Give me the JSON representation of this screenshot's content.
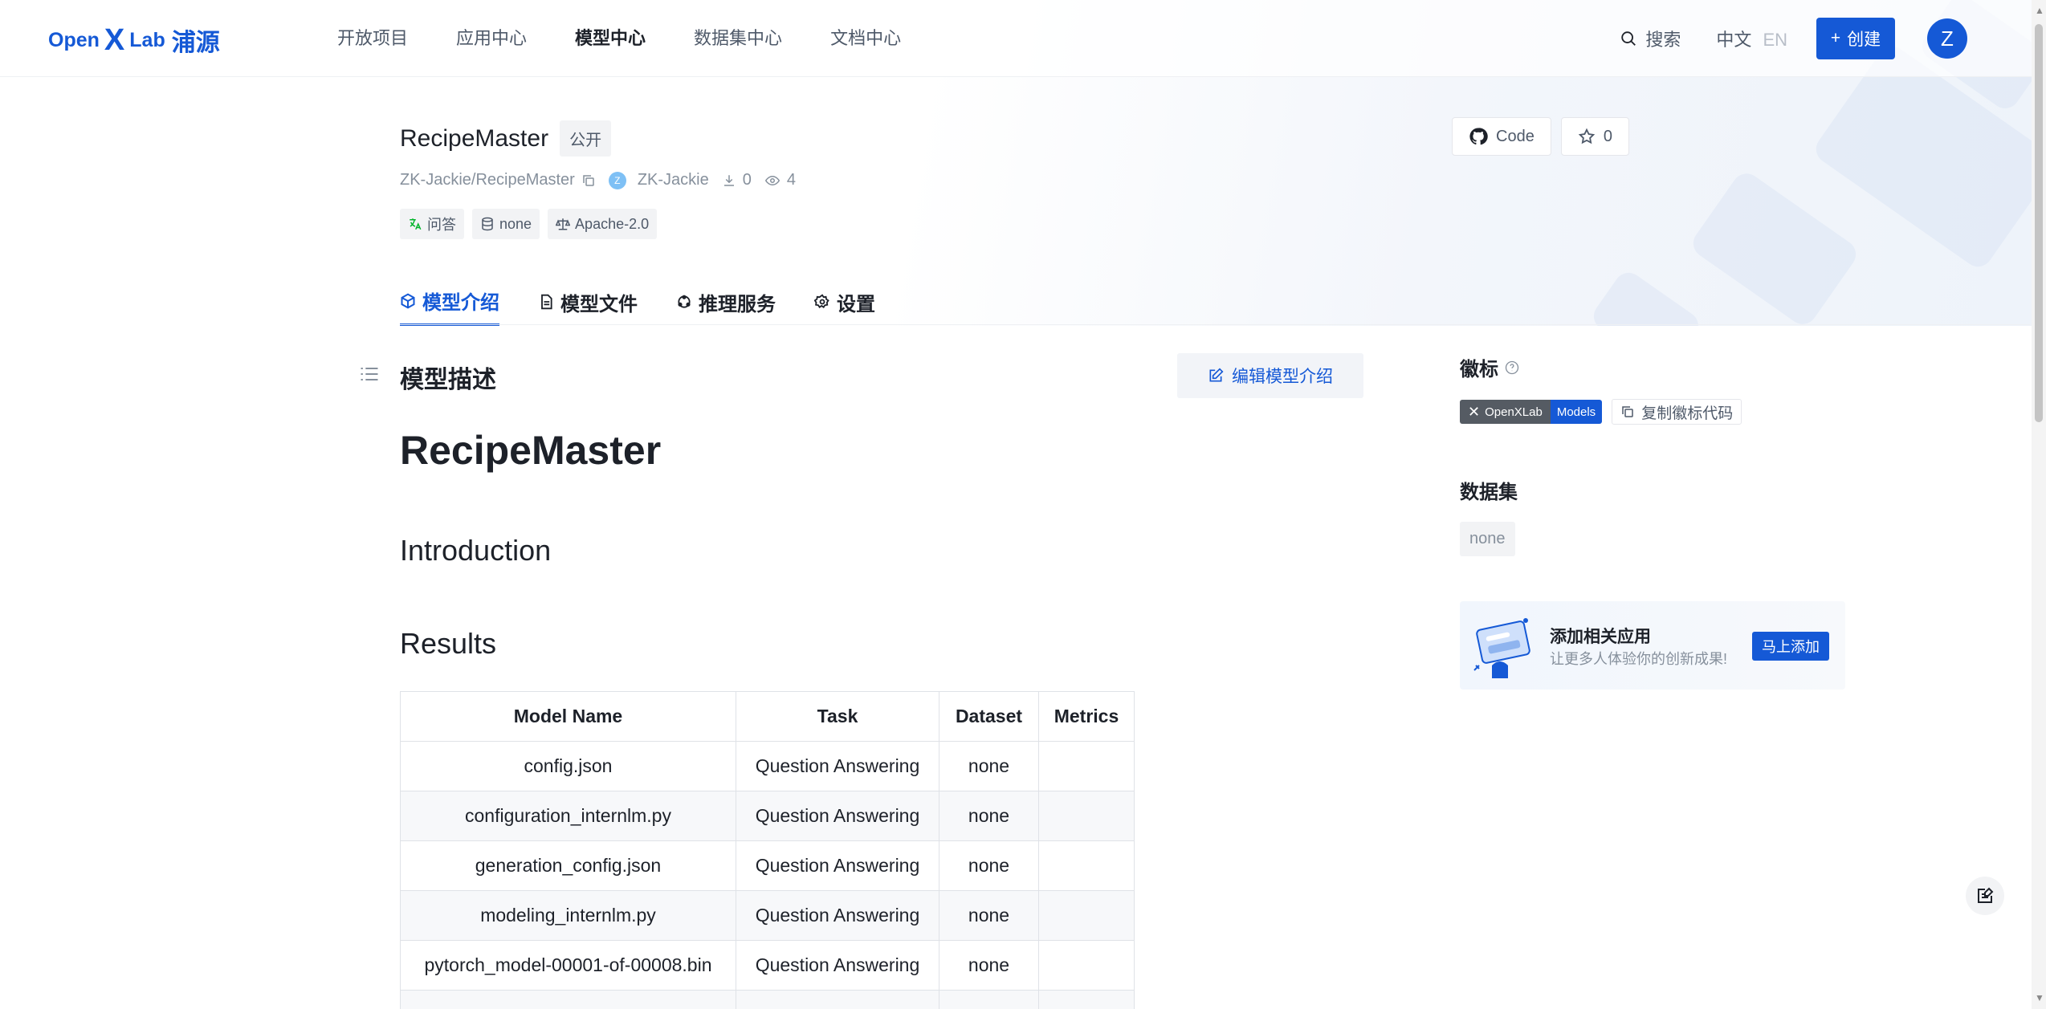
{
  "header": {
    "logo": {
      "open": "Open",
      "x": "X",
      "lab": "Lab",
      "cn": "浦源"
    },
    "nav": [
      "开放项目",
      "应用中心",
      "模型中心",
      "数据集中心",
      "文档中心"
    ],
    "nav_active_index": 2,
    "search_label": "搜索",
    "lang_zh": "中文",
    "lang_en": "EN",
    "create_label": "创建",
    "avatar_letter": "Z"
  },
  "repo": {
    "name": "RecipeMaster",
    "visibility": "公开",
    "path": "ZK-Jackie/RecipeMaster",
    "owner_avatar": "Z",
    "owner": "ZK-Jackie",
    "downloads": "0",
    "views": "4",
    "tags": [
      "问答",
      "none",
      "Apache-2.0"
    ],
    "code_label": "Code",
    "stars": "0"
  },
  "tabs": [
    "模型介绍",
    "模型文件",
    "推理服务",
    "设置"
  ],
  "content": {
    "section_title": "模型描述",
    "edit_label": "编辑模型介绍",
    "h1": "RecipeMaster",
    "h2_intro": "Introduction",
    "h2_results": "Results",
    "table": {
      "headers": [
        "Model Name",
        "Task",
        "Dataset",
        "Metrics"
      ],
      "rows": [
        [
          "config.json",
          "Question Answering",
          "none",
          ""
        ],
        [
          "configuration_internlm.py",
          "Question Answering",
          "none",
          ""
        ],
        [
          "generation_config.json",
          "Question Answering",
          "none",
          ""
        ],
        [
          "modeling_internlm.py",
          "Question Answering",
          "none",
          ""
        ],
        [
          "pytorch_model-00001-of-00008.bin",
          "Question Answering",
          "none",
          ""
        ]
      ]
    }
  },
  "sidebar": {
    "badge_title": "徽标",
    "badge_left": "OpenXLab",
    "badge_right": "Models",
    "copy_badge_label": "复制徽标代码",
    "dataset_title": "数据集",
    "dataset_tag": "none",
    "promo_title": "添加相关应用",
    "promo_sub": "让更多人体验你的创新成果!",
    "promo_btn": "马上添加"
  },
  "colors": {
    "accent": "#1559d6",
    "text": "#1d2129",
    "muted": "#86909c"
  }
}
